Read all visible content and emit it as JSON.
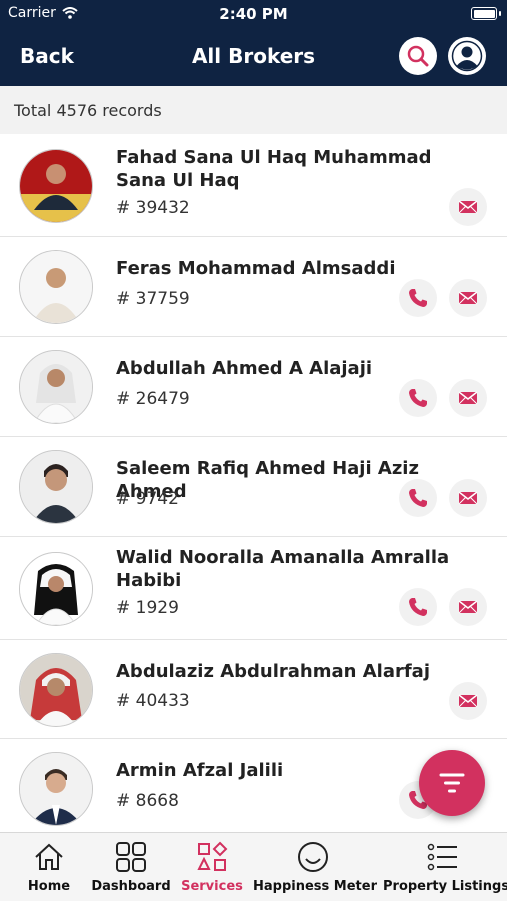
{
  "status_bar": {
    "carrier": "Carrier",
    "time": "2:40 PM"
  },
  "header": {
    "back_label": "Back",
    "title": "All Brokers"
  },
  "records": {
    "total_text": "Total 4576 records"
  },
  "brokers": [
    {
      "name": "Fahad  Sana Ul Haq Muhammad Sana Ul Haq",
      "id": "# 39432",
      "phone": false,
      "email": true
    },
    {
      "name": "Feras Mohammad Almsaddi",
      "id": "# 37759",
      "phone": true,
      "email": true
    },
    {
      "name": "Abdullah Ahmed A Alajaji",
      "id": "# 26479",
      "phone": true,
      "email": true
    },
    {
      "name": "Saleem Rafiq Ahmed Haji Aziz Ahmed",
      "id": "# 9742",
      "phone": true,
      "email": true
    },
    {
      "name": "Walid Nooralla Amanalla Amralla Habibi",
      "id": "# 1929",
      "phone": true,
      "email": true
    },
    {
      "name": "Abdulaziz Abdulrahman Alarfaj",
      "id": "# 40433",
      "phone": false,
      "email": true
    },
    {
      "name": "Armin Afzal Jalili",
      "id": "# 8668",
      "phone": true,
      "email": false
    }
  ],
  "tabs": [
    {
      "label": "Home",
      "icon": "home-icon",
      "active": false
    },
    {
      "label": "Dashboard",
      "icon": "dashboard-icon",
      "active": false
    },
    {
      "label": "Services",
      "icon": "services-icon",
      "active": true
    },
    {
      "label": "Happiness Meter",
      "icon": "smiley-icon",
      "active": false
    },
    {
      "label": "Property Listings",
      "icon": "list-icon",
      "active": false
    }
  ],
  "colors": {
    "header_bg": "#0f2342",
    "accent": "#d2315f",
    "action_bg": "#f1f1f1"
  }
}
